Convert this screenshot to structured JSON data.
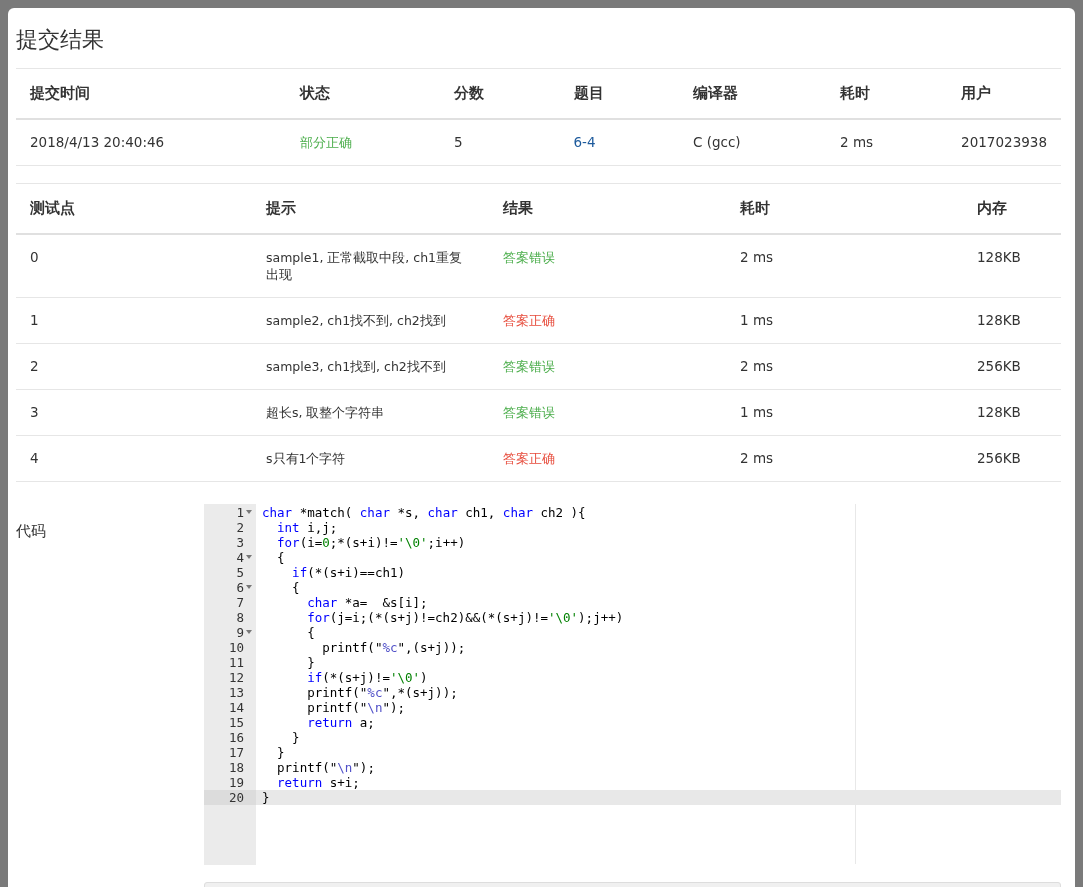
{
  "modal": {
    "title": "提交结果"
  },
  "submission": {
    "columns": [
      "提交时间",
      "状态",
      "分数",
      "题目",
      "编译器",
      "耗时",
      "用户"
    ],
    "row": {
      "time": "2018/4/13 20:40:46",
      "status": "部分正确",
      "score": "5",
      "problem": "6-4",
      "compiler": "C (gcc)",
      "duration": "2 ms",
      "user": "2017023938"
    }
  },
  "tests": {
    "columns": [
      "测试点",
      "提示",
      "结果",
      "耗时",
      "内存"
    ],
    "rows": [
      {
        "id": "0",
        "hint": "sample1, 正常截取中段, ch1重复出现",
        "result": "答案错误",
        "color": "#4cae4c",
        "duration": "2 ms",
        "memory": "128KB"
      },
      {
        "id": "1",
        "hint": "sample2, ch1找不到, ch2找到",
        "result": "答案正确",
        "color": "#e74c3c",
        "duration": "1 ms",
        "memory": "128KB"
      },
      {
        "id": "2",
        "hint": "sample3, ch1找到, ch2找不到",
        "result": "答案错误",
        "color": "#4cae4c",
        "duration": "2 ms",
        "memory": "256KB"
      },
      {
        "id": "3",
        "hint": "超长s, 取整个字符串",
        "result": "答案错误",
        "color": "#4cae4c",
        "duration": "1 ms",
        "memory": "128KB"
      },
      {
        "id": "4",
        "hint": "s只有1个字符",
        "result": "答案正确",
        "color": "#e74c3c",
        "duration": "2 ms",
        "memory": "256KB"
      }
    ]
  },
  "code": {
    "label": "代码",
    "lines": [
      {
        "number": "1",
        "foldable": true,
        "active": false,
        "tokens": [
          {
            "kind": "keyword",
            "text": "char"
          },
          {
            "kind": "plain",
            "text": " *match( "
          },
          {
            "kind": "keyword",
            "text": "char"
          },
          {
            "kind": "plain",
            "text": " *s, "
          },
          {
            "kind": "keyword",
            "text": "char"
          },
          {
            "kind": "plain",
            "text": " ch1, "
          },
          {
            "kind": "keyword",
            "text": "char"
          },
          {
            "kind": "plain",
            "text": " ch2 ){"
          }
        ]
      },
      {
        "number": "2",
        "foldable": false,
        "active": false,
        "tokens": [
          {
            "kind": "keyword",
            "text": "  int"
          },
          {
            "kind": "plain",
            "text": " i,j;"
          }
        ]
      },
      {
        "number": "3",
        "foldable": false,
        "active": false,
        "tokens": [
          {
            "kind": "keyword",
            "text": "  for"
          },
          {
            "kind": "plain",
            "text": "(i="
          },
          {
            "kind": "literal",
            "text": "0"
          },
          {
            "kind": "plain",
            "text": ";*(s+i)!="
          },
          {
            "kind": "literal",
            "text": "'\\0'"
          },
          {
            "kind": "plain",
            "text": ";i++)"
          }
        ]
      },
      {
        "number": "4",
        "foldable": true,
        "active": false,
        "tokens": [
          {
            "kind": "plain",
            "text": "  {"
          }
        ]
      },
      {
        "number": "5",
        "foldable": false,
        "active": false,
        "tokens": [
          {
            "kind": "keyword",
            "text": "    if"
          },
          {
            "kind": "plain",
            "text": "(*(s+i)==ch1)"
          }
        ]
      },
      {
        "number": "6",
        "foldable": true,
        "active": false,
        "tokens": [
          {
            "kind": "plain",
            "text": "    {"
          }
        ]
      },
      {
        "number": "7",
        "foldable": false,
        "active": false,
        "tokens": [
          {
            "kind": "keyword",
            "text": "      char"
          },
          {
            "kind": "plain",
            "text": " *a=  &s[i];"
          }
        ]
      },
      {
        "number": "8",
        "foldable": false,
        "active": false,
        "tokens": [
          {
            "kind": "keyword",
            "text": "      for"
          },
          {
            "kind": "plain",
            "text": "(j=i;(*(s+j)!=ch2)&&(*(s+j)!="
          },
          {
            "kind": "literal",
            "text": "'\\0'"
          },
          {
            "kind": "plain",
            "text": ");j++)"
          }
        ]
      },
      {
        "number": "9",
        "foldable": true,
        "active": false,
        "tokens": [
          {
            "kind": "plain",
            "text": "      {"
          }
        ]
      },
      {
        "number": "10",
        "foldable": false,
        "active": false,
        "tokens": [
          {
            "kind": "plain",
            "text": "        printf(\""
          },
          {
            "kind": "format",
            "text": "%c"
          },
          {
            "kind": "plain",
            "text": "\",(s+j));"
          }
        ]
      },
      {
        "number": "11",
        "foldable": false,
        "active": false,
        "tokens": [
          {
            "kind": "plain",
            "text": "      }"
          }
        ]
      },
      {
        "number": "12",
        "foldable": false,
        "active": false,
        "tokens": [
          {
            "kind": "keyword",
            "text": "      if"
          },
          {
            "kind": "plain",
            "text": "(*(s+j)!="
          },
          {
            "kind": "literal",
            "text": "'\\0'"
          },
          {
            "kind": "plain",
            "text": ")"
          }
        ]
      },
      {
        "number": "13",
        "foldable": false,
        "active": false,
        "tokens": [
          {
            "kind": "plain",
            "text": "      printf(\""
          },
          {
            "kind": "format",
            "text": "%c"
          },
          {
            "kind": "plain",
            "text": "\",*(s+j));"
          }
        ]
      },
      {
        "number": "14",
        "foldable": false,
        "active": false,
        "tokens": [
          {
            "kind": "plain",
            "text": "      printf(\""
          },
          {
            "kind": "format",
            "text": "\\n"
          },
          {
            "kind": "plain",
            "text": "\");"
          }
        ]
      },
      {
        "number": "15",
        "foldable": false,
        "active": false,
        "tokens": [
          {
            "kind": "keyword",
            "text": "      return"
          },
          {
            "kind": "plain",
            "text": " a;"
          }
        ]
      },
      {
        "number": "16",
        "foldable": false,
        "active": false,
        "tokens": [
          {
            "kind": "plain",
            "text": "    }"
          }
        ]
      },
      {
        "number": "17",
        "foldable": false,
        "active": false,
        "tokens": [
          {
            "kind": "plain",
            "text": "  }"
          }
        ]
      },
      {
        "number": "18",
        "foldable": false,
        "active": false,
        "tokens": [
          {
            "kind": "plain",
            "text": "  printf(\""
          },
          {
            "kind": "format",
            "text": "\\n"
          },
          {
            "kind": "plain",
            "text": "\");"
          }
        ]
      },
      {
        "number": "19",
        "foldable": false,
        "active": false,
        "tokens": [
          {
            "kind": "keyword",
            "text": "  return"
          },
          {
            "kind": "plain",
            "text": " s+i;"
          }
        ]
      },
      {
        "number": "20",
        "foldable": false,
        "active": true,
        "tokens": [
          {
            "kind": "plain",
            "text": "}"
          }
        ]
      }
    ]
  }
}
